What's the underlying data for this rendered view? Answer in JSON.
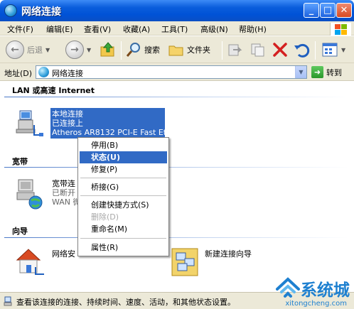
{
  "window": {
    "title": "网络连接"
  },
  "menu": [
    "文件(F)",
    "编辑(E)",
    "查看(V)",
    "收藏(A)",
    "工具(T)",
    "高级(N)",
    "帮助(H)"
  ],
  "toolbar": {
    "back": "后退",
    "search": "搜索",
    "folders": "文件夹"
  },
  "address": {
    "label": "地址(D)",
    "value": "网络连接",
    "go": "转到"
  },
  "groups": {
    "lan": "LAN 或高速 Internet",
    "broadband": "宽带",
    "wizard": "向导"
  },
  "items": {
    "lan": {
      "name": "本地连接",
      "status": "已连接上",
      "device": "Atheros AR8132 PCI-E Fast Et..."
    },
    "broadband": {
      "name": "宽带连",
      "status": "已断开",
      "device": "WAN 微"
    },
    "wizard_home": {
      "name": "网络安"
    },
    "wizard_new": {
      "name": "新建连接向导"
    }
  },
  "context_menu": [
    {
      "label": "停用(B)",
      "state": "normal"
    },
    {
      "label": "状态(U)",
      "state": "active"
    },
    {
      "label": "修复(P)",
      "state": "normal"
    },
    {
      "label": "桥接(G)",
      "state": "normal"
    },
    {
      "label": "创建快捷方式(S)",
      "state": "normal"
    },
    {
      "label": "删除(D)",
      "state": "disabled"
    },
    {
      "label": "重命名(M)",
      "state": "normal"
    },
    {
      "label": "属性(R)",
      "state": "normal"
    }
  ],
  "status": {
    "text": "查看该连接的连接、持续时间、速度、活动，和其他状态设置。"
  },
  "watermark": {
    "brand": "系统城",
    "url": "xitongcheng.com"
  }
}
